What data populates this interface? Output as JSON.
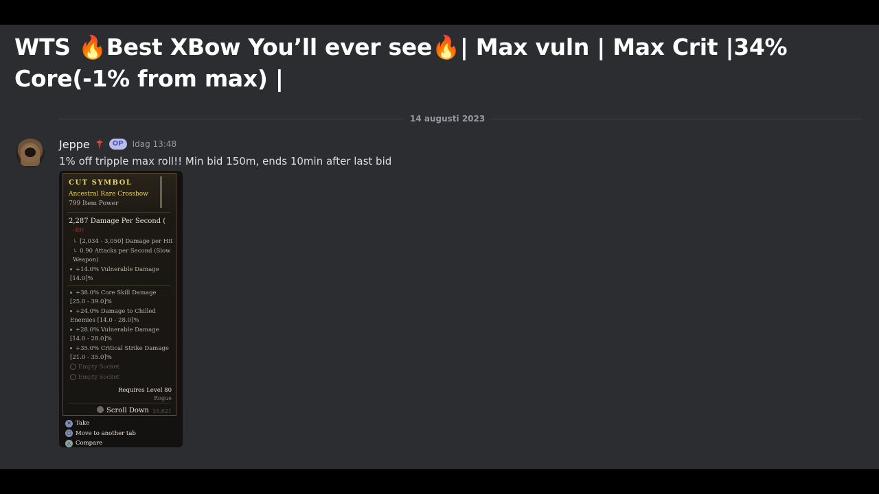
{
  "thread": {
    "title": "WTS 🔥Best XBow You’ll ever see🔥| Max vuln | Max Crit |34% Core(-1% from max) |"
  },
  "date_divider": "14 augusti 2023",
  "message": {
    "username": "Jeppe",
    "badge": "OP",
    "timestamp": "Idag 13:48",
    "text": "1% off tripple max roll!! Min bid 150m, ends 10min after last bid"
  },
  "item_tooltip": {
    "name": "CUT SYMBOL",
    "type": "Ancestral Rare Crossbow",
    "power": "799 Item Power",
    "dps": "2,287 Damage Per Second  (",
    "dps_change": "-49)",
    "sub": [
      "[2,034 - 3,050] Damage per Hit",
      "0.90 Attacks per Second (Slow Weapon)"
    ],
    "implicit": "+14.0% Vulnerable Damage [14.0]%",
    "affixes": [
      "+38.0% Core Skill Damage [25.0 - 39.0]%",
      "+24.0% Damage to Chilled Enemies [14.0 - 28.0]%",
      "+28.0% Vulnerable Damage [14.0 - 28.0]%",
      "+35.0% Critical Strike Damage [21.0 - 35.0]%"
    ],
    "sockets": [
      "Empty Socket",
      "Empty Socket"
    ],
    "requires": "Requires Level 80",
    "class": "Rogue",
    "scroll": "Scroll Down",
    "gold": "35,621"
  },
  "controls": [
    {
      "button": "✕",
      "label": "Take"
    },
    {
      "button": "▢",
      "label": "Move to another tab"
    },
    {
      "button": "△",
      "label": "Compare"
    }
  ]
}
